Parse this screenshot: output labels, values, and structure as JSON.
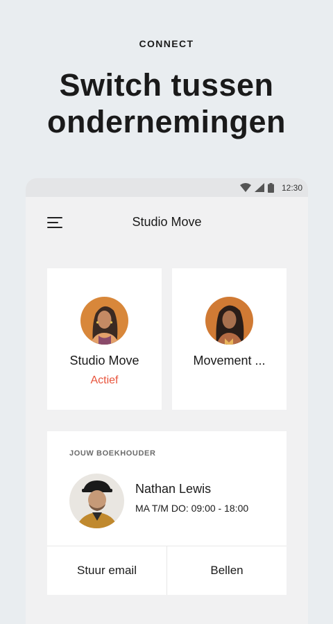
{
  "promo": {
    "kicker": "CONNECT",
    "headline_line1": "Switch tussen",
    "headline_line2": "ondernemingen"
  },
  "status_bar": {
    "time": "12:30",
    "icons": [
      "wifi-icon",
      "signal-icon",
      "battery-icon"
    ]
  },
  "app_bar": {
    "menu_icon": "hamburger-menu-icon",
    "title": "Studio Move"
  },
  "businesses": [
    {
      "name": "Studio Move",
      "status": "Actief",
      "status_color": "#e8543c"
    },
    {
      "name": "Movement ...",
      "status": ""
    }
  ],
  "accountant": {
    "label": "JOUW BOEKHOUDER",
    "name": "Nathan Lewis",
    "hours": "MA T/M DO: 09:00 - 18:00",
    "email_label": "Stuur email",
    "call_label": "Bellen"
  },
  "colors": {
    "background": "#e9edf0",
    "accent_active": "#e8543c",
    "card": "#ffffff"
  }
}
